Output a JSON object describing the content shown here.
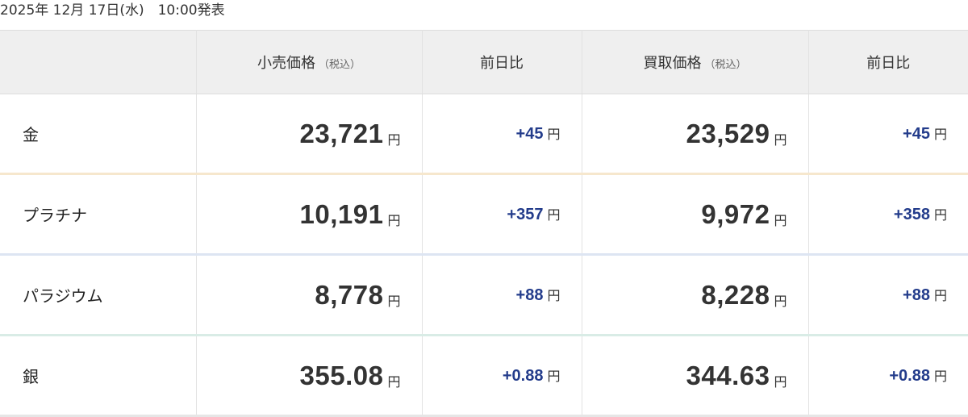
{
  "header": {
    "timestamp": "2025年 12月 17日(水)　10:00発表"
  },
  "table": {
    "columns": {
      "retail": "小売価格",
      "retail_tax": "（税込）",
      "retail_change": "前日比",
      "buy": "買取価格",
      "buy_tax": "（税込）",
      "buy_change": "前日比"
    },
    "rows": [
      {
        "name": "金",
        "retail_price": "23,721",
        "retail_unit": "円",
        "retail_change": "+45",
        "retail_change_unit": "円",
        "buy_price": "23,529",
        "buy_unit": "円",
        "buy_change": "+45",
        "buy_change_unit": "円"
      },
      {
        "name": "プラチナ",
        "retail_price": "10,191",
        "retail_unit": "円",
        "retail_change": "+357",
        "retail_change_unit": "円",
        "buy_price": "9,972",
        "buy_unit": "円",
        "buy_change": "+358",
        "buy_change_unit": "円"
      },
      {
        "name": "パラジウム",
        "retail_price": "8,778",
        "retail_unit": "円",
        "retail_change": "+88",
        "retail_change_unit": "円",
        "buy_price": "8,228",
        "buy_unit": "円",
        "buy_change": "+88",
        "buy_change_unit": "円"
      },
      {
        "name": "銀",
        "retail_price": "355.08",
        "retail_unit": "円",
        "retail_change": "+0.88",
        "retail_change_unit": "円",
        "buy_price": "344.63",
        "buy_unit": "円",
        "buy_change": "+0.88",
        "buy_change_unit": "円"
      }
    ]
  },
  "colors": {
    "change_text": "#233c8b",
    "header_bg": "#efefef",
    "gold_rule": "#f6e7cd",
    "platinum_rule": "#dde5f2",
    "palladium_rule": "#d9ece6",
    "silver_rule": "#e6e6e6"
  }
}
